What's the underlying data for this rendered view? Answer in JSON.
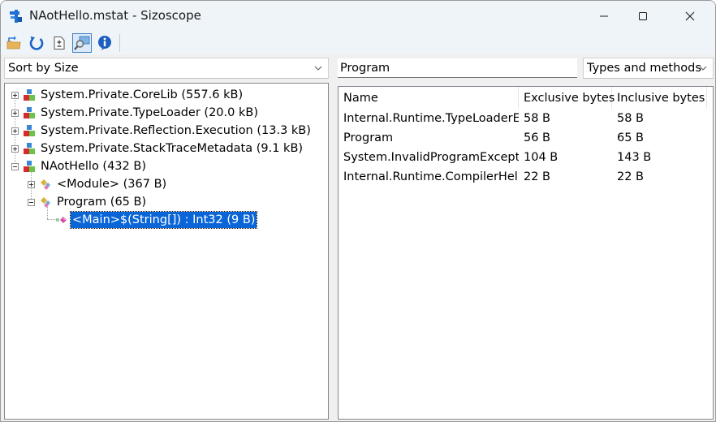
{
  "window": {
    "title": "NAotHello.mstat - Sizoscope",
    "app_icon": "sizoscope-icon",
    "controls": [
      "minimize",
      "maximize",
      "close"
    ]
  },
  "toolbar": {
    "buttons": [
      {
        "name": "open-file",
        "icon": "open-folder-icon",
        "active": false
      },
      {
        "name": "refresh",
        "icon": "refresh-icon",
        "active": false
      },
      {
        "name": "diff",
        "icon": "diff-document-icon",
        "active": false
      },
      {
        "name": "search",
        "icon": "search-window-icon",
        "active": true
      },
      {
        "name": "about",
        "icon": "info-icon",
        "active": false
      }
    ]
  },
  "left": {
    "sort_select": {
      "value": "Sort by Size"
    },
    "tree": [
      {
        "label": "System.Private.CoreLib (557.6 kB)",
        "kind": "assembly",
        "level": 0,
        "expander": "plus"
      },
      {
        "label": "System.Private.TypeLoader (20.0 kB)",
        "kind": "assembly",
        "level": 0,
        "expander": "plus"
      },
      {
        "label": "System.Private.Reflection.Execution (13.3 kB)",
        "kind": "assembly",
        "level": 0,
        "expander": "plus"
      },
      {
        "label": "System.Private.StackTraceMetadata (9.1 kB)",
        "kind": "assembly",
        "level": 0,
        "expander": "plus"
      },
      {
        "label": "NAotHello (432 B)",
        "kind": "assembly",
        "level": 0,
        "expander": "minus"
      },
      {
        "label": "<Module> (367 B)",
        "kind": "class",
        "level": 1,
        "expander": "plus"
      },
      {
        "label": "Program (65 B)",
        "kind": "class",
        "level": 1,
        "expander": "minus"
      },
      {
        "label": "<Main>$(String[]) : Int32 (9 B)",
        "kind": "method",
        "level": 2,
        "expander": "none",
        "selected": true
      }
    ]
  },
  "right": {
    "filter_input": {
      "value": "Program"
    },
    "kind_select": {
      "value": "Types and methods"
    },
    "columns": [
      "Name",
      "Exclusive bytes",
      "Inclusive bytes"
    ],
    "rows": [
      [
        "Internal.Runtime.TypeLoaderEx...",
        "58 B",
        "58 B"
      ],
      [
        "Program",
        "56 B",
        "65 B"
      ],
      [
        "System.InvalidProgramExcepti...",
        "104 B",
        "143 B"
      ],
      [
        "Internal.Runtime.CompilerHelp...",
        "22 B",
        "22 B"
      ]
    ]
  }
}
